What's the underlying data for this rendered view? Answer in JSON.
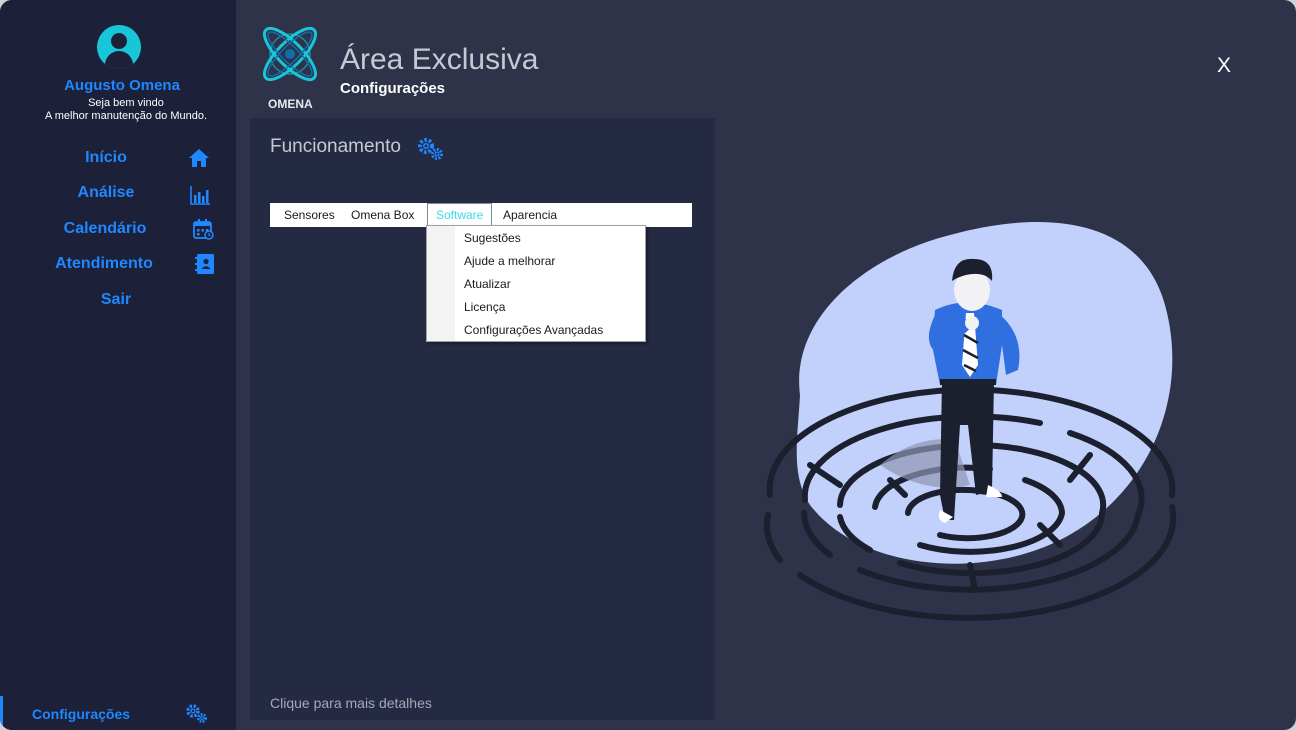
{
  "colors": {
    "accent": "#1e88ff",
    "avatar": "#18c6d8",
    "sidebar_bg": "#1c2039",
    "window_bg": "#2f3349",
    "panel_bg": "#252a43",
    "active_menu_text": "#3fd7f0",
    "blob": "#c2d1fb"
  },
  "user": {
    "name": "Augusto Omena",
    "greeting": "Seja bem vindo",
    "motto": "A melhor manutenção do Mundo."
  },
  "sidebar": {
    "items": [
      {
        "label": "Início",
        "icon": "home-icon"
      },
      {
        "label": "Análise",
        "icon": "bar-chart-icon"
      },
      {
        "label": "Calendário",
        "icon": "calendar-icon"
      },
      {
        "label": "Atendimento",
        "icon": "contact-book-icon"
      },
      {
        "label": "Sair",
        "icon": ""
      }
    ],
    "footer_item": {
      "label": "Configurações",
      "icon": "gears-icon"
    }
  },
  "header": {
    "logo_text": "OMENA",
    "title": "Área Exclusiva",
    "subtitle": "Configurações",
    "close_label": "X"
  },
  "panel": {
    "title": "Funcionamento",
    "title_icon": "gears-icon",
    "menu": {
      "items": [
        "Sensores",
        "Omena Box",
        "Software",
        "Aparencia"
      ],
      "open_item": "Software",
      "dropdown": [
        "Sugestões",
        "Ajude a melhorar",
        "Atualizar",
        "Licença",
        "Configurações Avançadas"
      ]
    },
    "footer": "Clique para mais detalhes"
  }
}
